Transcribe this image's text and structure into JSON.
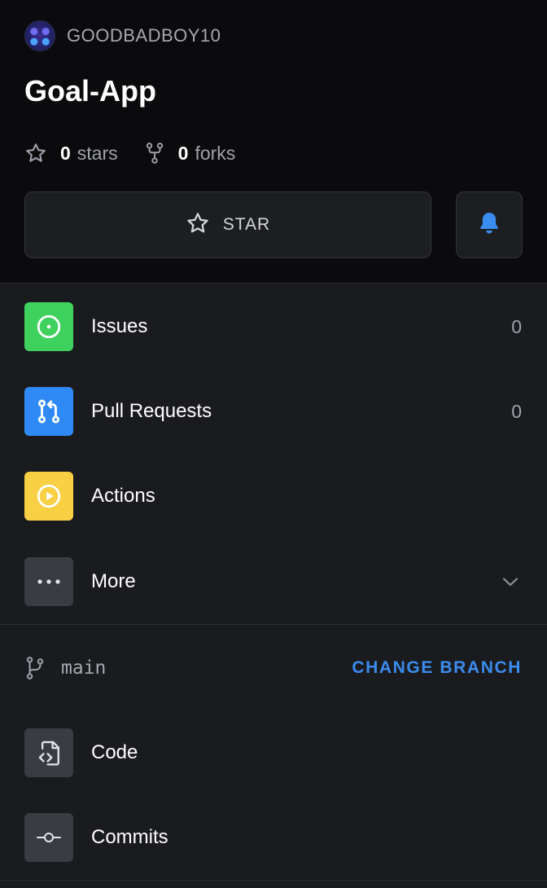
{
  "header": {
    "owner": "GOODBADBOY10",
    "repo_name": "Goal-App",
    "stars_count": "0",
    "stars_label": "stars",
    "forks_count": "0",
    "forks_label": "forks",
    "star_button_label": "STAR"
  },
  "menu": {
    "items": [
      {
        "label": "Issues",
        "count": "0",
        "icon": "issue-opened-icon",
        "color": "#3fd15e"
      },
      {
        "label": "Pull Requests",
        "count": "0",
        "icon": "git-pull-request-icon",
        "color": "#2f8af5"
      },
      {
        "label": "Actions",
        "icon": "play-icon",
        "color": "#f9cf43"
      },
      {
        "label": "More",
        "icon": "kebab-horizontal-icon",
        "color": "#3a3c43"
      }
    ]
  },
  "branch": {
    "name": "main",
    "change_label": "CHANGE BRANCH"
  },
  "code_items": [
    {
      "label": "Code",
      "icon": "file-code-icon"
    },
    {
      "label": "Commits",
      "icon": "git-commit-icon"
    }
  ],
  "colors": {
    "accent_blue": "#3b8cf0",
    "header_bg": "#0b0b0d",
    "body_bg": "#1a1b1f"
  }
}
